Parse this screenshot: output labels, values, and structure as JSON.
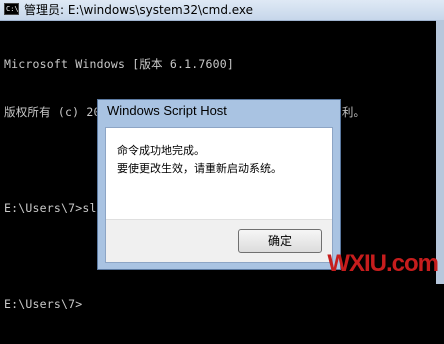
{
  "window": {
    "title": "管理员: E:\\windows\\system32\\cmd.exe",
    "icon": "cmd-icon"
  },
  "console": {
    "lines": [
      "Microsoft Windows [版本 6.1.7600]",
      "版权所有 (c) 2009 Microsoft Corporation。保留所有权利。",
      "",
      "E:\\Users\\7>slmgr /rearm",
      "",
      "E:\\Users\\7>"
    ]
  },
  "dialog": {
    "title": "Windows Script Host",
    "message_line1": "命令成功地完成。",
    "message_line2": "要使更改生效，请重新启动系统。",
    "ok_label": "确定"
  },
  "watermark": "WXIU.com",
  "colors": {
    "console_bg": "#000000",
    "console_text": "#c9c9c9",
    "dialog_frame": "#a9c3e2",
    "watermark": "#c61d1d"
  }
}
